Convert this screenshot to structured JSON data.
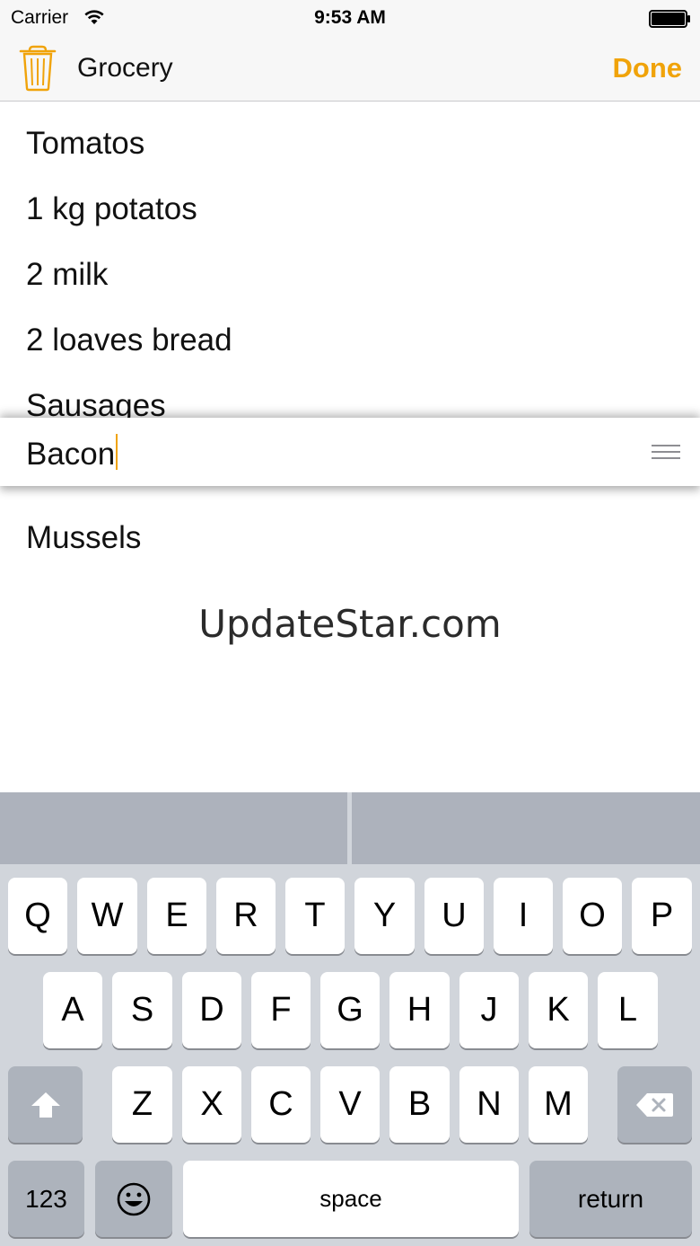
{
  "status_bar": {
    "carrier": "Carrier",
    "time": "9:53 AM",
    "wifi_icon": "wifi-icon",
    "battery_icon": "battery-icon"
  },
  "nav": {
    "title": "Grocery",
    "done_label": "Done",
    "trash_icon": "trash-icon",
    "accent_color": "#f0a30a"
  },
  "list": {
    "items": [
      "Tomatos",
      "1 kg potatos",
      "2 milk",
      "2 loaves bread",
      "Sausages"
    ],
    "dragged_item": "Bacon",
    "after_items": [
      "Mussels"
    ]
  },
  "watermark": "UpdateStar.com",
  "keyboard": {
    "row1": [
      "Q",
      "W",
      "E",
      "R",
      "T",
      "Y",
      "U",
      "I",
      "O",
      "P"
    ],
    "row2": [
      "A",
      "S",
      "D",
      "F",
      "G",
      "H",
      "J",
      "K",
      "L"
    ],
    "row3": [
      "Z",
      "X",
      "C",
      "V",
      "B",
      "N",
      "M"
    ],
    "numbers_label": "123",
    "space_label": "space",
    "return_label": "return",
    "shift_icon": "shift-icon",
    "delete_icon": "delete-icon",
    "emoji_icon": "emoji-icon"
  }
}
